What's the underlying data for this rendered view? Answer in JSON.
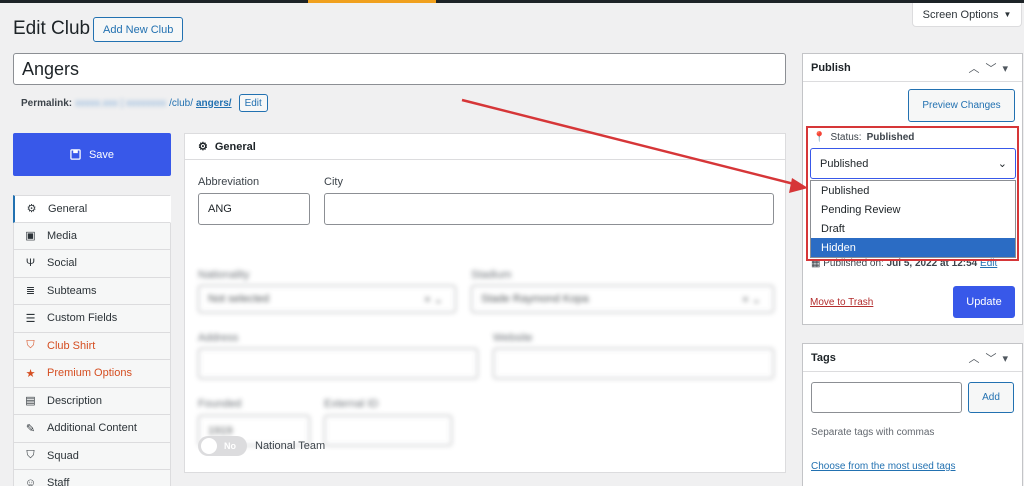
{
  "colors": {
    "accent": "#3858e9",
    "link": "#2271b1",
    "annotation": "#d63638",
    "selected_option": "#2b6cc4"
  },
  "header": {
    "screen_options": "Screen Options",
    "page_title": "Edit Club",
    "add_new": "Add New Club"
  },
  "post": {
    "title": "Angers",
    "permalink_label": "Permalink:",
    "permalink_path": "/club/",
    "permalink_slug": "angers/",
    "permalink_edit": "Edit"
  },
  "sidebar": {
    "save_label": "Save",
    "tabs": [
      {
        "label": "General",
        "icon": "gear-icon"
      },
      {
        "label": "Media",
        "icon": "camera-icon"
      },
      {
        "label": "Social",
        "icon": "social-icon"
      },
      {
        "label": "Subteams",
        "icon": "database-icon"
      },
      {
        "label": "Custom Fields",
        "icon": "list-icon"
      },
      {
        "label": "Club Shirt",
        "icon": "shirt-icon"
      },
      {
        "label": "Premium Options",
        "icon": "star-icon"
      },
      {
        "label": "Description",
        "icon": "document-icon"
      },
      {
        "label": "Additional Content",
        "icon": "pencil-icon"
      },
      {
        "label": "Squad",
        "icon": "shirt-icon"
      },
      {
        "label": "Staff",
        "icon": "people-icon"
      }
    ]
  },
  "general": {
    "heading": "General",
    "abbreviation_label": "Abbreviation",
    "abbreviation_value": "ANG",
    "city_label": "City",
    "city_value": "",
    "national_team_toggle": "No",
    "national_team_label": "National Team"
  },
  "publish": {
    "heading": "Publish",
    "preview": "Preview Changes",
    "status_label": "Status:",
    "status_value": "Published",
    "selected": "Published",
    "options": [
      "Published",
      "Pending Review",
      "Draft",
      "Hidden"
    ],
    "highlighted_option": "Hidden",
    "published_on_label": "Published on:",
    "published_on_date": "Jul 5, 2022 at 12:54",
    "published_on_edit": "Edit",
    "trash": "Move to Trash",
    "update": "Update"
  },
  "tags": {
    "heading": "Tags",
    "add": "Add",
    "hint": "Separate tags with commas",
    "choose_link": "Choose from the most used tags"
  }
}
